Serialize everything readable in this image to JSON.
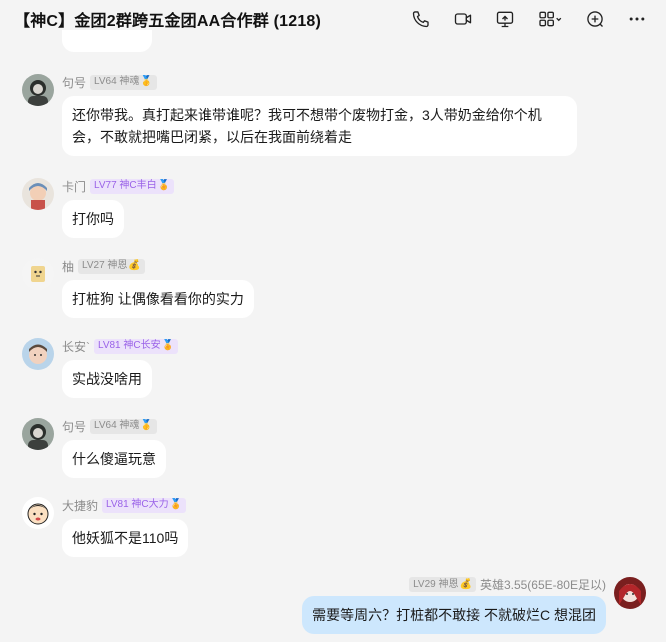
{
  "window": {
    "title": "【神C】金团2群跨五金团AA合作群 (1218)"
  },
  "toolbar": {
    "icons": [
      "phone-icon",
      "video-call-icon",
      "screen-share-icon",
      "apps-icon",
      "add-icon",
      "more-icon"
    ]
  },
  "messages": [
    {
      "nick": "句号",
      "tag": "LV64 神魂",
      "tag_style": "grey",
      "medal": "🥇",
      "text": "还你带我。真打起来谁带谁呢？我可不想带个废物打金，3人带奶金给你个机会，不敢就把嘴巴闭紧，以后在我面前绕着走"
    },
    {
      "nick": "卡门",
      "tag": "LV77 神C丰白",
      "tag_style": "purple",
      "medal": "🏅",
      "text": "打你吗"
    },
    {
      "nick": "柚",
      "tag": "LV27 神恩",
      "tag_style": "grey",
      "medal": "💰",
      "text": "打桩狗 让偶像看看你的实力"
    },
    {
      "nick": "长安`",
      "tag": "LV81 神C长安",
      "tag_style": "purple",
      "medal": "🏅",
      "text": "实战没啥用"
    },
    {
      "nick": "句号",
      "tag": "LV64 神魂",
      "tag_style": "grey",
      "medal": "🥇",
      "text": "什么傻逼玩意"
    },
    {
      "nick": "大捷豹",
      "tag": "LV81 神C大力",
      "tag_style": "purple",
      "medal": "🏅",
      "text": "他妖狐不是110吗"
    }
  ],
  "own_message": {
    "tag": "LV29 神恩",
    "medal": "💰",
    "nick": "英雄3.55(65E-80E足以)",
    "text": "需要等周六？打桩都不敢接 不就破烂C 想混团"
  },
  "colors": {
    "background": "#f4f4f4",
    "bubble": "#ffffff",
    "own_bubble": "#cde7fd",
    "purple_tag_bg": "#ece2fb",
    "purple_tag_text": "#9a62e8"
  }
}
